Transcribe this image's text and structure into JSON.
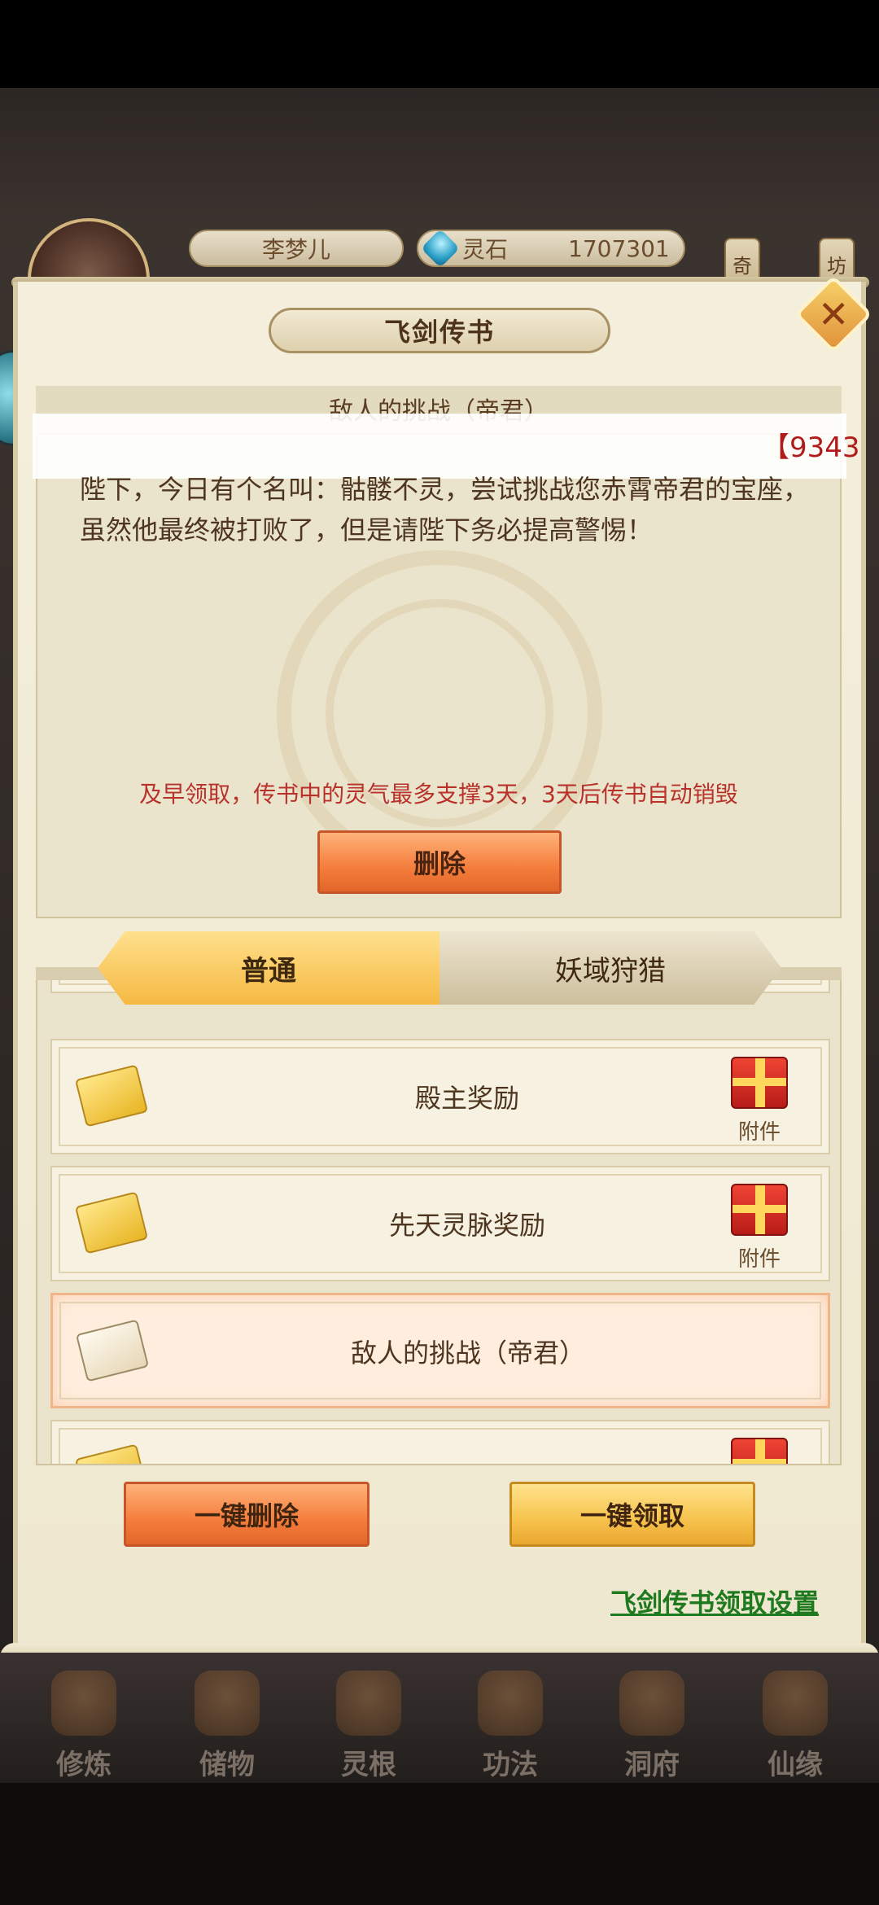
{
  "header": {
    "player_name": "李梦儿",
    "currency_name": "灵石",
    "currency_amount": "1707301",
    "side_tab_1": "奇",
    "side_tab_2": "坊"
  },
  "dialog": {
    "title": "飞剑传书",
    "close_symbol": "✕"
  },
  "overlay_badge": "【9343",
  "detail": {
    "subject": "敌人的挑战（帝君）",
    "body": "陛下，今日有个名叫：骷髅不灵，尝试挑战您赤霄帝君的宝座，虽然他最终被打败了，但是请陛下务必提高警惕！",
    "warning": "及早领取，传书中的灵气最多支撑3天，3天后传书自动销毁",
    "delete_label": "删除"
  },
  "tabs": [
    {
      "label": "普通",
      "active": true
    },
    {
      "label": "妖域狩猎",
      "active": false
    }
  ],
  "mails": [
    {
      "title": "殿主奖励",
      "attachment": "附件",
      "opened": false,
      "selected": false
    },
    {
      "title": "先天灵脉奖励",
      "attachment": "附件",
      "opened": false,
      "selected": false
    },
    {
      "title": "敌人的挑战（帝君）",
      "attachment": "",
      "opened": true,
      "selected": true
    }
  ],
  "bulk": {
    "delete_all": "一键删除",
    "claim_all": "一键领取"
  },
  "settings_link": "飞剑传书领取设置",
  "nav": [
    {
      "label": "修炼",
      "icon": "cultivate-icon"
    },
    {
      "label": "储物",
      "icon": "storage-bag-icon"
    },
    {
      "label": "灵根",
      "icon": "spirit-root-icon"
    },
    {
      "label": "功法",
      "icon": "technique-book-icon"
    },
    {
      "label": "洞府",
      "icon": "cave-house-icon"
    },
    {
      "label": "仙缘",
      "icon": "immortal-fate-icon"
    }
  ],
  "colors": {
    "accent_orange": "#f47d3b",
    "accent_gold": "#f6c24c",
    "warning_red": "#b8322b",
    "link_green": "#1f7a1f"
  }
}
